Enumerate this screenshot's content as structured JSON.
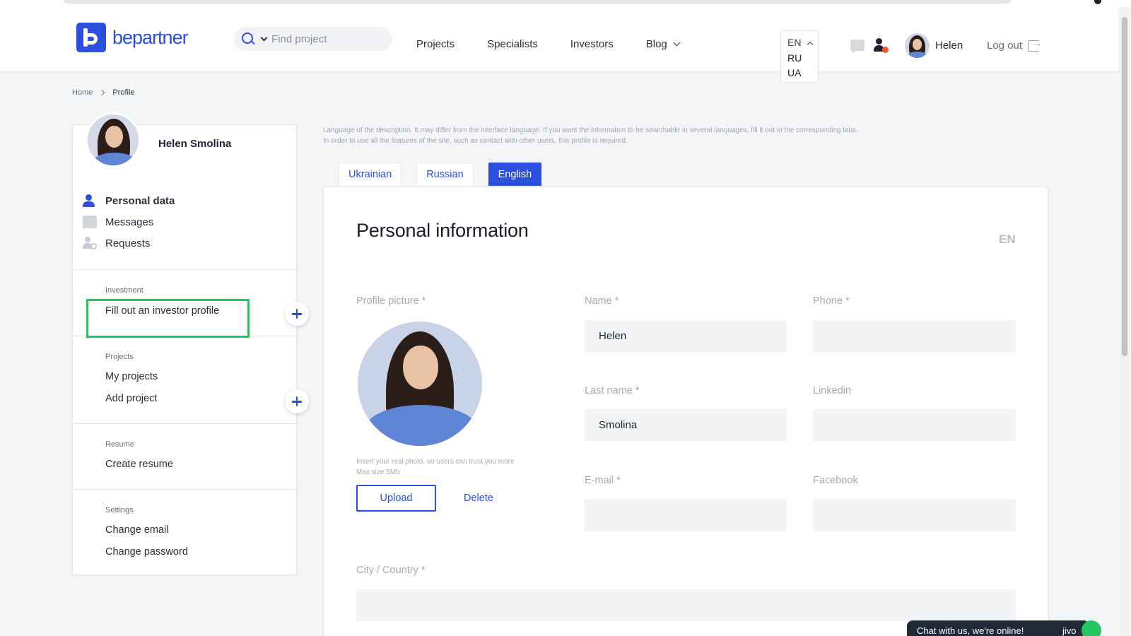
{
  "header": {
    "logo_text": "bepartner",
    "search": {
      "placeholder": "Find project",
      "value": ""
    },
    "nav": [
      "Projects",
      "Specialists",
      "Investors",
      "Blog"
    ],
    "languages": {
      "current": "EN",
      "options": [
        "RU",
        "UA"
      ]
    },
    "user_name": "Helen",
    "logout_label": "Log out"
  },
  "breadcrumb": {
    "home": "Home",
    "current": "Profile"
  },
  "sidebar": {
    "name": "Helen Smolina",
    "menu": [
      "Personal data",
      "Messages",
      "Requests"
    ],
    "sections": {
      "investment": {
        "label": "Investment",
        "link": "Fill out an investor profile"
      },
      "projects": {
        "label": "Projects",
        "links": [
          "My projects",
          "Add project"
        ]
      },
      "resume": {
        "label": "Resume",
        "link": "Create resume"
      },
      "settings": {
        "label": "Settings",
        "links": [
          "Change email",
          "Change password"
        ]
      }
    }
  },
  "main": {
    "hint_line1": "Language of the description. It may differ from the interface language. If you want the information to be searchable in several languages, fill it out in the corresponding tabs.",
    "hint_line2": "In order to use all the features of the site, such as contact with other users, this profile is required.",
    "tabs": [
      "Ukrainian",
      "Russian",
      "English"
    ],
    "active_tab": "English",
    "title": "Personal information",
    "lang_badge": "EN",
    "profile_picture_label": "Profile picture *",
    "photo_hint_line1": "Insert your real photo, so users can trust you more",
    "photo_hint_line2": "Max size 5Mb",
    "upload_label": "Upload",
    "delete_label": "Delete",
    "fields": {
      "name": {
        "label": "Name *",
        "value": "Helen"
      },
      "phone": {
        "label": "Phone *",
        "value": ""
      },
      "last_name": {
        "label": "Last name *",
        "value": "Smolina"
      },
      "linkedin": {
        "label": "Linkedin",
        "value": ""
      },
      "email": {
        "label": "E-mail *",
        "value": ""
      },
      "facebook": {
        "label": "Facebook",
        "value": ""
      },
      "city": {
        "label": "City / Country *",
        "value": ""
      }
    }
  },
  "chat": {
    "text": "Chat with us, we're online!",
    "brand": "jivo"
  },
  "colors": {
    "accent": "#2d4fe0",
    "highlight": "#22c55e",
    "notification": "#ef5a28"
  }
}
